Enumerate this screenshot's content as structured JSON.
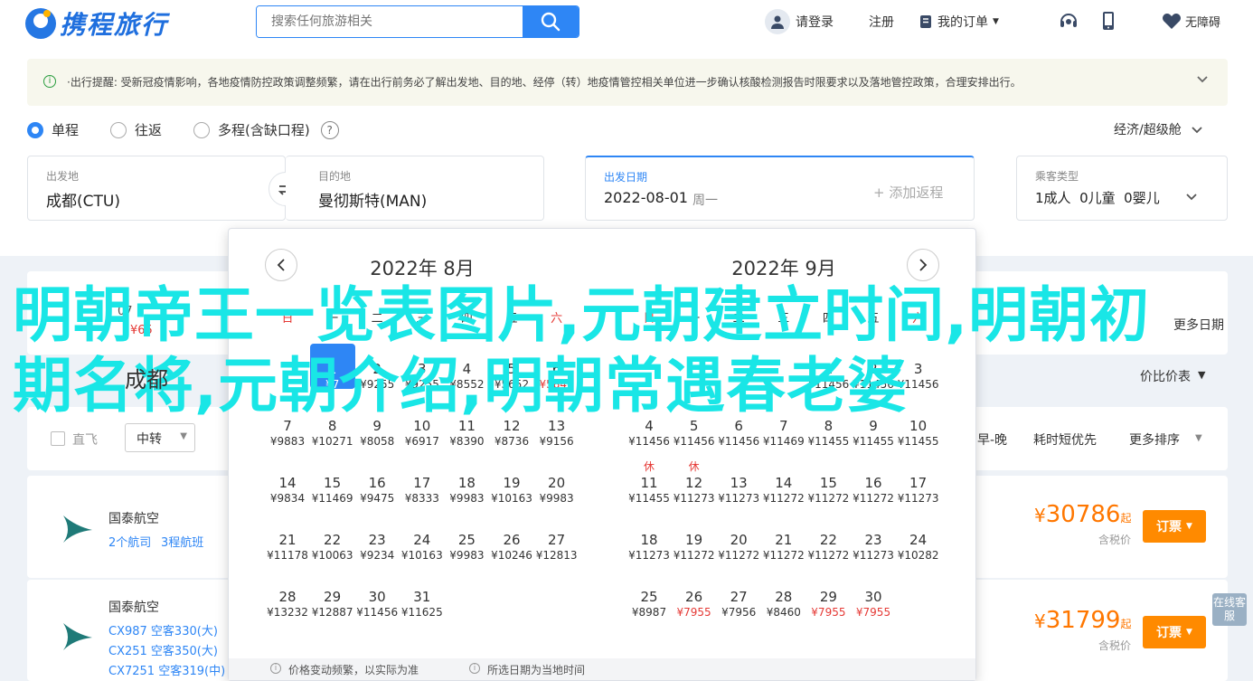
{
  "header": {
    "logo_text": "携程旅行",
    "search_placeholder": "搜索任何旅游相关",
    "login": "请登录",
    "register": "注册",
    "orders": "我的订单",
    "service": "",
    "app": "",
    "accessible": "无障碍"
  },
  "notice": {
    "text": "·出行提醒: 受新冠疫情影响，各地疫情防控政策调整频繁，请在出行前务必了解出发地、目的地、经停（转）地疫情管控相关单位进一步确认核酸检测报告时限要求以及落地管控政策，合理安排出行。"
  },
  "trip_types": [
    {
      "label": "单程",
      "selected": true
    },
    {
      "label": "往返",
      "selected": false
    },
    {
      "label": "多程(含缺口程)",
      "selected": false
    }
  ],
  "cabin": "经济/超级舱",
  "search_form": {
    "from_label": "出发地",
    "from_value": "成都(CTU)",
    "to_label": "目的地",
    "to_value": "曼彻斯特(MAN)",
    "date_label": "出发日期",
    "date_value": "2022-08-01",
    "date_weekday": "周一",
    "add_return": "+ 添加返程",
    "passenger_label": "乘客类型",
    "passengers": "1成人  0儿童  0婴儿"
  },
  "calendar": {
    "left_title": "2022年 8月",
    "right_title": "2022年 9月",
    "weekdays": [
      "日",
      "一",
      "二",
      "三",
      "四",
      "五",
      "六"
    ],
    "aug_days": [
      {
        "d": "1",
        "p": "¥7",
        "col": 1,
        "row": 0,
        "sel": true
      },
      {
        "d": "2",
        "p": "¥9255",
        "col": 2,
        "row": 0
      },
      {
        "d": "3",
        "p": "¥9255",
        "col": 3,
        "row": 0
      },
      {
        "d": "4",
        "p": "¥8552",
        "col": 4,
        "row": 0
      },
      {
        "d": "5",
        "p": "¥5652",
        "col": 5,
        "row": 0
      },
      {
        "d": "6",
        "p": "¥5840",
        "col": 6,
        "row": 0,
        "red": true
      },
      {
        "d": "7",
        "p": "¥9883",
        "col": 0,
        "row": 1
      },
      {
        "d": "8",
        "p": "¥10271",
        "col": 1,
        "row": 1
      },
      {
        "d": "9",
        "p": "¥8058",
        "col": 2,
        "row": 1
      },
      {
        "d": "10",
        "p": "¥6917",
        "col": 3,
        "row": 1
      },
      {
        "d": "11",
        "p": "¥8390",
        "col": 4,
        "row": 1
      },
      {
        "d": "12",
        "p": "¥8736",
        "col": 5,
        "row": 1
      },
      {
        "d": "13",
        "p": "¥9156",
        "col": 6,
        "row": 1
      },
      {
        "d": "14",
        "p": "¥9834",
        "col": 0,
        "row": 2
      },
      {
        "d": "15",
        "p": "¥11469",
        "col": 1,
        "row": 2
      },
      {
        "d": "16",
        "p": "¥9475",
        "col": 2,
        "row": 2
      },
      {
        "d": "17",
        "p": "¥8333",
        "col": 3,
        "row": 2
      },
      {
        "d": "18",
        "p": "¥9983",
        "col": 4,
        "row": 2
      },
      {
        "d": "19",
        "p": "¥10163",
        "col": 5,
        "row": 2
      },
      {
        "d": "20",
        "p": "¥9983",
        "col": 6,
        "row": 2
      },
      {
        "d": "21",
        "p": "¥11178",
        "col": 0,
        "row": 3
      },
      {
        "d": "22",
        "p": "¥10063",
        "col": 1,
        "row": 3
      },
      {
        "d": "23",
        "p": "¥9234",
        "col": 2,
        "row": 3
      },
      {
        "d": "24",
        "p": "¥10163",
        "col": 3,
        "row": 3
      },
      {
        "d": "25",
        "p": "¥9983",
        "col": 4,
        "row": 3
      },
      {
        "d": "26",
        "p": "¥10246",
        "col": 5,
        "row": 3
      },
      {
        "d": "27",
        "p": "¥12813",
        "col": 6,
        "row": 3
      },
      {
        "d": "28",
        "p": "¥13232",
        "col": 0,
        "row": 4
      },
      {
        "d": "29",
        "p": "¥12887",
        "col": 1,
        "row": 4
      },
      {
        "d": "30",
        "p": "¥11456",
        "col": 2,
        "row": 4
      },
      {
        "d": "31",
        "p": "¥11625",
        "col": 3,
        "row": 4
      }
    ],
    "sep_days": [
      {
        "d": "1",
        "p": "¥11456",
        "col": 4,
        "row": 0
      },
      {
        "d": "2",
        "p": "¥11456",
        "col": 5,
        "row": 0
      },
      {
        "d": "3",
        "p": "¥11456",
        "col": 6,
        "row": 0
      },
      {
        "d": "4",
        "p": "¥11456",
        "col": 0,
        "row": 1
      },
      {
        "d": "5",
        "p": "¥11456",
        "col": 1,
        "row": 1
      },
      {
        "d": "6",
        "p": "¥11456",
        "col": 2,
        "row": 1
      },
      {
        "d": "7",
        "p": "¥11469",
        "col": 3,
        "row": 1
      },
      {
        "d": "8",
        "p": "¥11455",
        "col": 4,
        "row": 1
      },
      {
        "d": "9",
        "p": "¥11455",
        "col": 5,
        "row": 1
      },
      {
        "d": "10",
        "p": "¥11455",
        "col": 6,
        "row": 1
      },
      {
        "d": "11",
        "p": "¥11455",
        "col": 0,
        "row": 2,
        "h": "休"
      },
      {
        "d": "12",
        "p": "¥11273",
        "col": 1,
        "row": 2,
        "h": "休"
      },
      {
        "d": "13",
        "p": "¥11273",
        "col": 2,
        "row": 2
      },
      {
        "d": "14",
        "p": "¥11272",
        "col": 3,
        "row": 2
      },
      {
        "d": "15",
        "p": "¥11272",
        "col": 4,
        "row": 2
      },
      {
        "d": "16",
        "p": "¥11272",
        "col": 5,
        "row": 2
      },
      {
        "d": "17",
        "p": "¥11273",
        "col": 6,
        "row": 2
      },
      {
        "d": "18",
        "p": "¥11273",
        "col": 0,
        "row": 3
      },
      {
        "d": "19",
        "p": "¥11272",
        "col": 1,
        "row": 3
      },
      {
        "d": "20",
        "p": "¥11272",
        "col": 2,
        "row": 3
      },
      {
        "d": "21",
        "p": "¥11272",
        "col": 3,
        "row": 3
      },
      {
        "d": "22",
        "p": "¥11272",
        "col": 4,
        "row": 3
      },
      {
        "d": "23",
        "p": "¥11273",
        "col": 5,
        "row": 3
      },
      {
        "d": "24",
        "p": "¥10282",
        "col": 6,
        "row": 3
      },
      {
        "d": "25",
        "p": "¥8987",
        "col": 0,
        "row": 4
      },
      {
        "d": "26",
        "p": "¥7955",
        "col": 1,
        "row": 4,
        "red": true
      },
      {
        "d": "27",
        "p": "¥7956",
        "col": 2,
        "row": 4
      },
      {
        "d": "28",
        "p": "¥8460",
        "col": 3,
        "row": 4
      },
      {
        "d": "29",
        "p": "¥7955",
        "col": 4,
        "row": 4,
        "red": true
      },
      {
        "d": "30",
        "p": "¥7955",
        "col": 5,
        "row": 4,
        "red": true
      }
    ],
    "foot_left": "价格变动频繁，以实际为准",
    "foot_right": "所选日期为当地时间"
  },
  "behind": {
    "city_text": "成都",
    "more_dates": "更多日期",
    "price_compare": "价比价表",
    "low_date_prefix": "07",
    "low_price_prefix": "¥65",
    "filter_direct": "直飞",
    "filter_transfer": "中转",
    "sort_early_late": "早-晚",
    "sort_time": "耗时短优先",
    "sort_more": "更多排序"
  },
  "flights": [
    {
      "airline": "国泰航空",
      "sub1": "2个航司",
      "sub2": "3程航班",
      "price": "30786",
      "suffix": "起",
      "tax": "含税价",
      "book": "订票"
    },
    {
      "airline": "国泰航空",
      "sub1": "CX987 空客330(大)",
      "sub2": "CX251 空客350(大)",
      "sub3": "CX7251 空客319(中)",
      "price": "31799",
      "suffix": "起",
      "tax": "含税价",
      "book": "订票"
    }
  ],
  "overlay_text": "明朝帝王一览表图片,元朝建立时间,明朝初期名将,元朝介绍,明朝常遇春老婆",
  "float_service": "在线客服"
}
